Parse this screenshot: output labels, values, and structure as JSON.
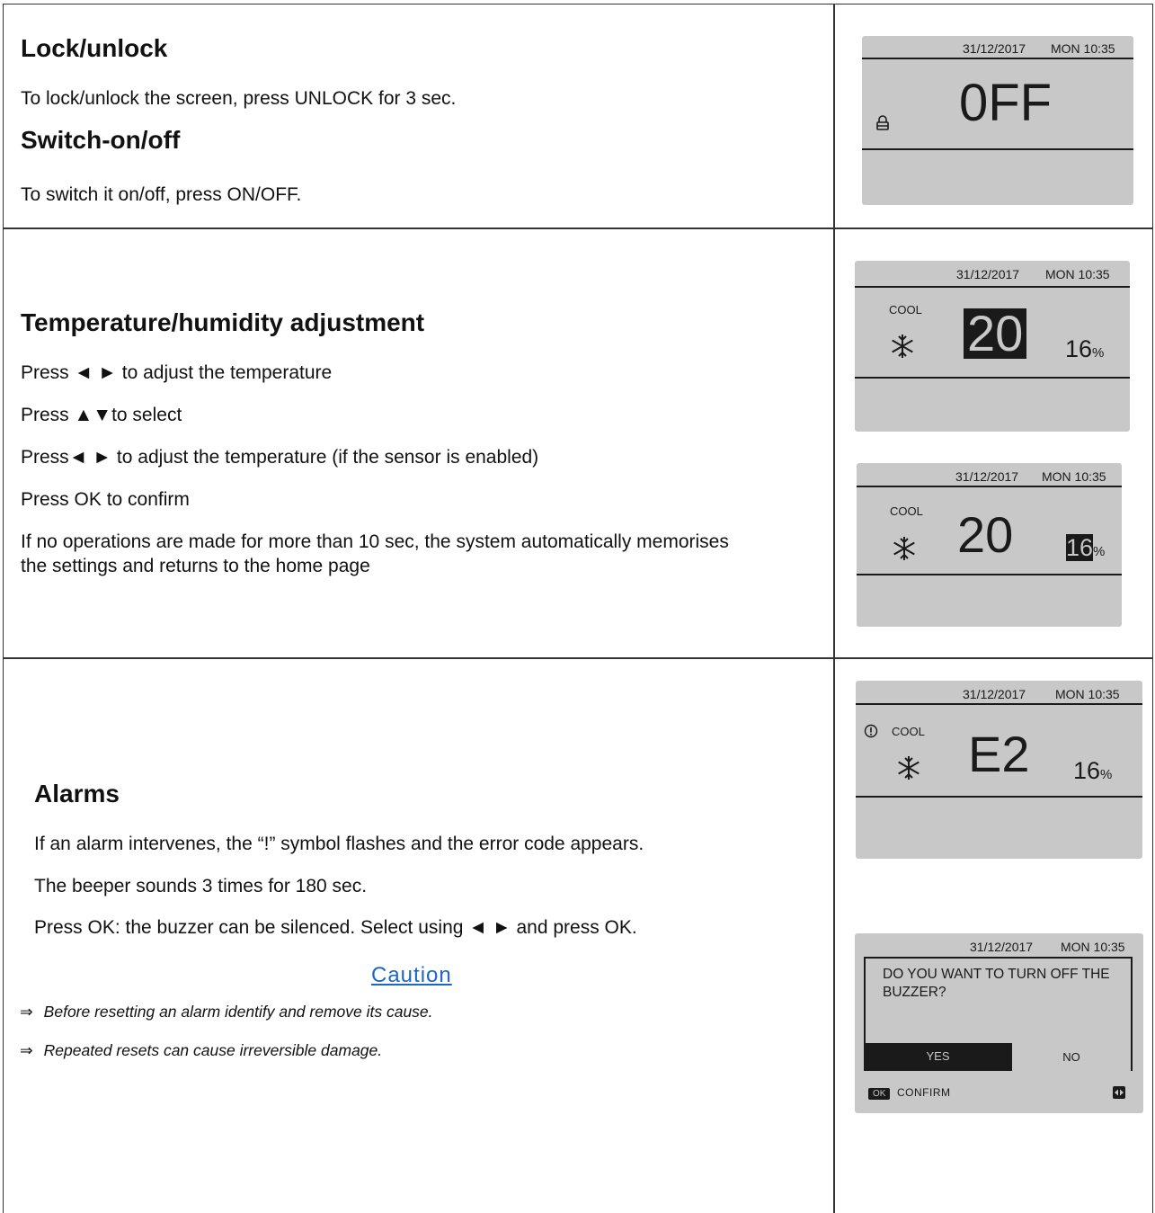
{
  "sections": {
    "lock": {
      "title": "Lock/unlock",
      "text": "To lock/unlock the screen, press UNLOCK for 3 sec."
    },
    "switch": {
      "title": "Switch-on/off",
      "text": "To switch it on/off, press ON/OFF."
    },
    "temp": {
      "title": "Temperature/humidity adjustment",
      "lines": [
        "Press ◄ ► to adjust the temperature",
        "Press ▲▼to select",
        "Press◄ ► to adjust the temperature (if the sensor is enabled)",
        "Press OK to confirm",
        "If no operations are made for more than 10 sec, the system automatically memorises the settings and returns to the home page"
      ]
    },
    "alarms": {
      "title": "Alarms",
      "lines": [
        "If an alarm intervenes, the “!” symbol flashes and the error code appears.",
        "The beeper sounds 3 times for 180 sec.",
        "Press OK: the buzzer can be silenced. Select using ◄ ► and press OK."
      ],
      "caution": "Caution",
      "notes": [
        "Before resetting an alarm identify and remove its cause.",
        "Repeated resets can cause irreversible damage."
      ],
      "note_arrow": "⇒"
    }
  },
  "screens": {
    "date": "31/12/2017",
    "day_time": "MON 10:35",
    "off": "0FF",
    "mode": "COOL",
    "temp": "20",
    "humidity": "16",
    "pct": "%",
    "error": "E2",
    "dialog_question": "DO YOU WANT TO TURN OFF THE BUZZER?",
    "yes": "YES",
    "no": "NO",
    "ok_key": "OK",
    "confirm": "CONFIRM"
  }
}
